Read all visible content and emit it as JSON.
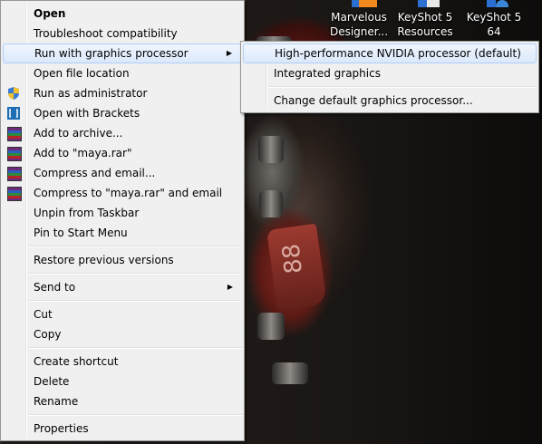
{
  "desktop": {
    "icons": [
      {
        "label_line1": "Marvelous",
        "label_line2": "Designer..."
      },
      {
        "label_line1": "KeyShot 5",
        "label_line2": "Resources"
      },
      {
        "label_line1": "KeyShot 5 64",
        "label_line2": ""
      }
    ],
    "wallpaper_text": "88"
  },
  "context_menu": {
    "items": [
      {
        "label": "Open"
      },
      {
        "label": "Troubleshoot compatibility"
      },
      {
        "label": "Run with graphics processor"
      },
      {
        "label": "Open file location"
      },
      {
        "label": "Run as administrator",
        "icon": "shield-icon"
      },
      {
        "label": "Open with Brackets",
        "icon": "brackets-icon"
      },
      {
        "label": "Add to archive...",
        "icon": "winrar-icon"
      },
      {
        "label": "Add to \"maya.rar\"",
        "icon": "winrar-icon"
      },
      {
        "label": "Compress and email...",
        "icon": "winrar-icon"
      },
      {
        "label": "Compress to \"maya.rar\" and email",
        "icon": "winrar-icon"
      },
      {
        "label": "Unpin from Taskbar"
      },
      {
        "label": "Pin to Start Menu"
      },
      {
        "label": "Restore previous versions"
      },
      {
        "label": "Send to"
      },
      {
        "label": "Cut"
      },
      {
        "label": "Copy"
      },
      {
        "label": "Create shortcut"
      },
      {
        "label": "Delete"
      },
      {
        "label": "Rename"
      },
      {
        "label": "Properties"
      }
    ]
  },
  "submenu": {
    "items": [
      {
        "label": "High-performance NVIDIA processor (default)"
      },
      {
        "label": "Integrated graphics"
      },
      {
        "label": "Change default graphics processor..."
      }
    ]
  },
  "colors": {
    "menu_bg": "#f0f0f0",
    "highlight_border": "#aecff7"
  }
}
